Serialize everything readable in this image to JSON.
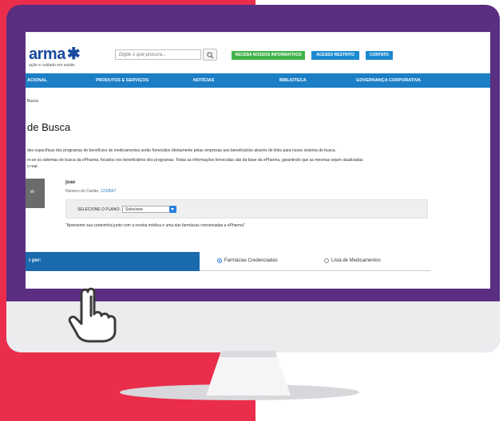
{
  "header": {
    "logo_text": "arma",
    "tagline": "ação e cuidado em saúde.",
    "search_placeholder": "Digite o que procura...",
    "btn_newsletter": "RECEBA NOSSOS INFORMATIVOS",
    "btn_restricted": "ACESSO RESTRITO",
    "btn_contact": "CONTATO"
  },
  "nav": {
    "items": [
      "ACIONAL",
      "PRODUTOS E SERVIÇOS",
      "NOTÍCIAS",
      "BIBLIOTECA",
      "GOVERNANÇA CORPORATIVA"
    ]
  },
  "breadcrumb": "Busca",
  "page_title": "de Busca",
  "paragraphs": {
    "p1": "des específicas dos programas de benefícios de medicamentos serão fornecidos diretamente pelas empresas aos beneficiários através de links para nosso sistema de busca.",
    "p2": "m-se os sistemas de busca da ePharma, focados nos beneficiários dos programas. Todas as informações fornecidas são da base da ePharma, garantindo que as mesmas sejam atualizadas",
    "p3": "o real."
  },
  "card": {
    "dark_label": "el",
    "user_name": "joao",
    "card_number_label": "Número do Cartão:",
    "card_number": "1234567"
  },
  "plan": {
    "label": "SELECIONE O PLANO:",
    "selected": "Selecione"
  },
  "notice": "\"Apresente sua carteirinha junto com a receita médica e uma das farmácias conveniadas a ePharma\"",
  "filter": {
    "label": "r por:",
    "option_pharmacies": "Farmácias Credenciadas",
    "option_medicines": "Lista de Medicamentos",
    "selected": "Farmácias Credenciadas"
  },
  "colors": {
    "brand_blue": "#1b4aa0",
    "nav_blue": "#1c7fc6",
    "monitor_purple": "#5a2e80",
    "background_red": "#ea2d4a",
    "newsletter_green": "#3fb34a"
  },
  "icons": [
    "star-person-icon",
    "magnifier-icon",
    "select-arrow-icon",
    "pointing-hand-icon"
  ]
}
